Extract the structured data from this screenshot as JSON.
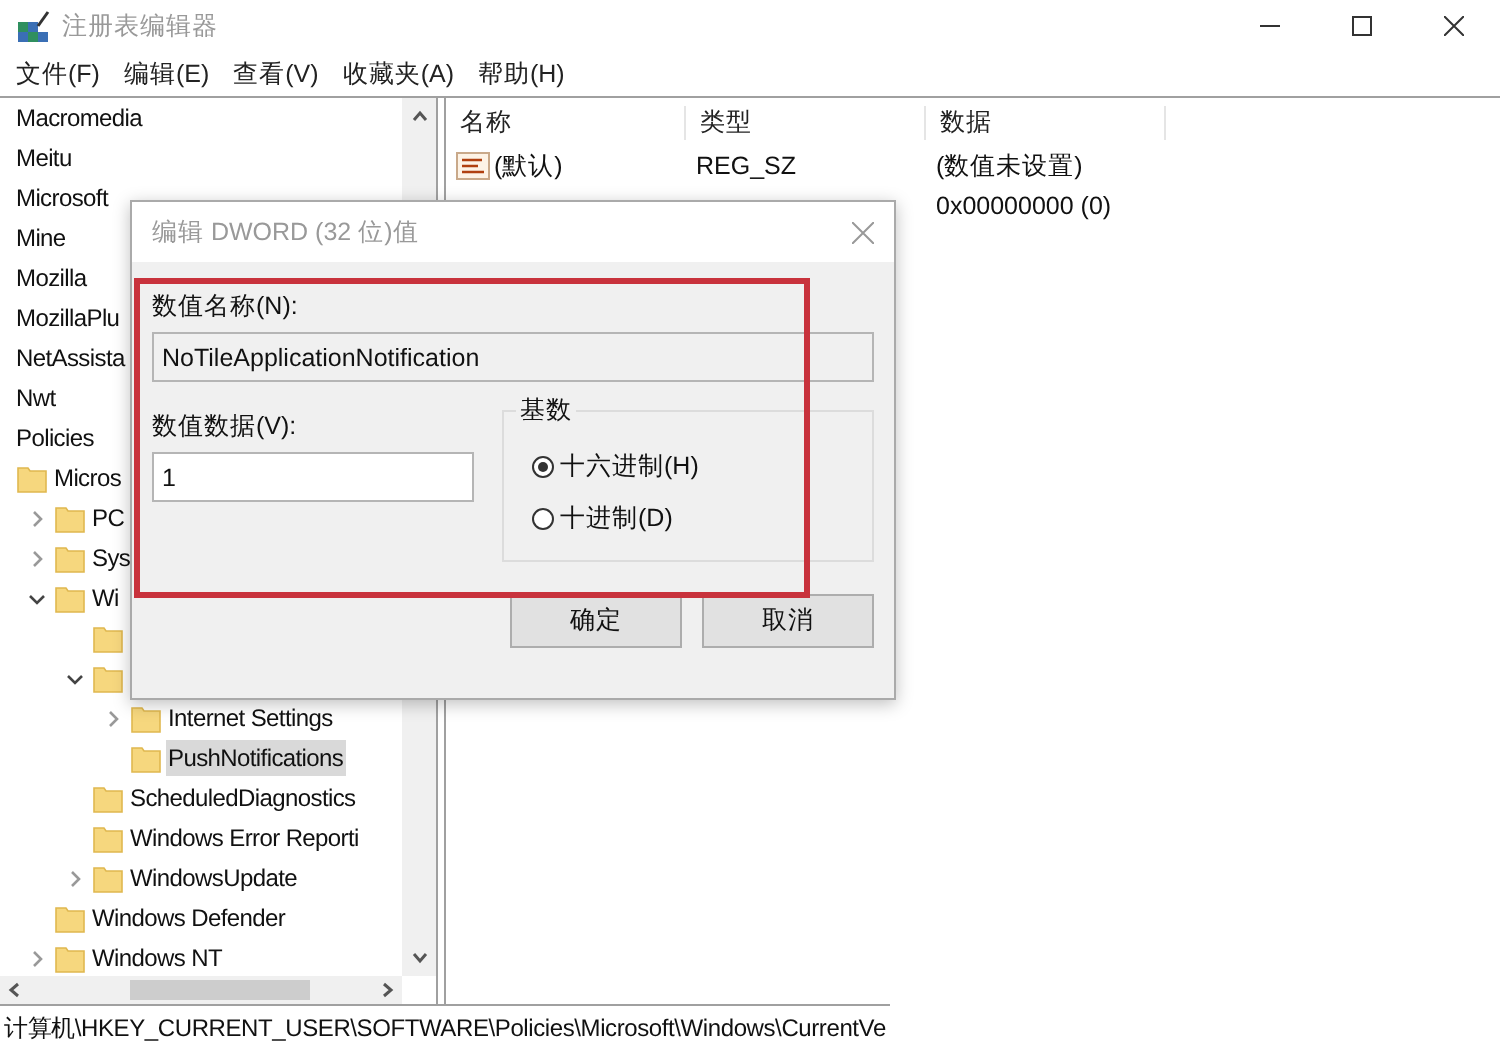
{
  "window": {
    "title": "注册表编辑器"
  },
  "menu": [
    "文件(F)",
    "编辑(E)",
    "查看(V)",
    "收藏夹(A)",
    "帮助(H)"
  ],
  "tree": [
    {
      "label": "Macromedia",
      "selected": false
    },
    {
      "label": "Meitu",
      "selected": false
    },
    {
      "label": "Microsoft",
      "selected": false
    },
    {
      "label": "Mine",
      "selected": false
    },
    {
      "label": "Mozilla",
      "selected": false
    },
    {
      "label": "MozillaPlu",
      "selected": false
    },
    {
      "label": "NetAssista",
      "selected": false
    },
    {
      "label": "Nwt",
      "selected": false
    },
    {
      "label": "Policies",
      "selected": false,
      "children": [
        {
          "label": "Micros",
          "selected": false,
          "children": [
            {
              "label": "PC",
              "selected": false,
              "expanded": false
            },
            {
              "label": "Sys",
              "selected": false,
              "expanded": false
            },
            {
              "label": "Wi",
              "selected": false,
              "expanded": true,
              "children": [
                {
                  "selected": false
                },
                {
                  "selected": false,
                  "expanded": true,
                  "children": [
                    {
                      "label": "Internet Settings",
                      "selected": false,
                      "expanded": false
                    },
                    {
                      "label": "PushNotifications",
                      "selected": true
                    }
                  ]
                },
                {
                  "label": "ScheduledDiagnostics",
                  "selected": false
                },
                {
                  "label": "Windows Error Reporti",
                  "selected": false
                },
                {
                  "label": "WindowsUpdate",
                  "selected": false,
                  "expanded": false
                }
              ]
            },
            {
              "label": "Windows Defender",
              "selected": false
            },
            {
              "label": "Windows NT",
              "selected": false,
              "expanded": false
            }
          ]
        }
      ]
    }
  ],
  "values": {
    "columns": [
      "名称",
      "类型",
      "数据"
    ],
    "rows": [
      {
        "kind": "string",
        "name": "(默认)",
        "type": "REG_SZ",
        "data": "(数值未设置)"
      },
      {
        "data": "0x00000000 (0)"
      }
    ]
  },
  "dialog": {
    "title": "编辑 DWORD (32 位)值",
    "name_label": "数值名称(N):",
    "name_value": "NoTileApplicationNotification",
    "data_label": "数值数据(V):",
    "data_value": "1",
    "base_label": "基数",
    "bases": [
      {
        "label": "十六进制(H)",
        "selected": true
      },
      {
        "label": "十进制(D)",
        "selected": false
      }
    ],
    "buttons": [
      "确定",
      "取消"
    ]
  },
  "status_bar": "计算机\\HKEY_CURRENT_USER\\SOFTWARE\\Policies\\Microsoft\\Windows\\CurrentVe"
}
